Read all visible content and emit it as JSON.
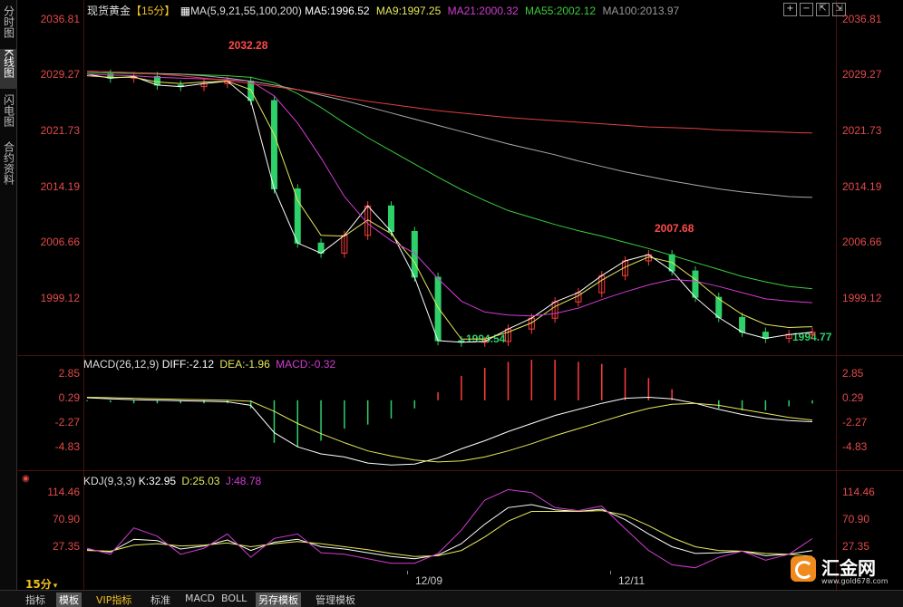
{
  "side_tabs": [
    "分时图",
    "K线图",
    "闪电图",
    "合约资料"
  ],
  "price_header": {
    "instrument": "现货黄金",
    "period": "【15分】",
    "ma_def": "MA(5,9,21,55,100,200)",
    "ma5": "MA5:1996.52",
    "ma9": "MA9:1997.25",
    "ma21": "MA21:2000.32",
    "ma55": "MA55:2002.12",
    "ma100": "MA100:2013.97"
  },
  "price_axis": [
    "2036.81",
    "2029.27",
    "2021.73",
    "2014.19",
    "2006.66",
    "1999.12"
  ],
  "annotations": {
    "high1": "2032.28",
    "high2": "2007.68",
    "low1": "1994.54",
    "low2": "1994.77"
  },
  "macd_header": {
    "def": "MACD(26,12,9)",
    "diff": "DIFF:-2.12",
    "dea": "DEA:-1.96",
    "macd": "MACD:-0.32"
  },
  "macd_axis": [
    "2.85",
    "0.29",
    "-2.27",
    "-4.83"
  ],
  "kdj_header": {
    "def": "KDJ(9,3,3)",
    "k": "K:32.95",
    "d": "D:25.03",
    "j": "J:48.78"
  },
  "kdj_axis": [
    "114.46",
    "70.90",
    "27.35"
  ],
  "dates": [
    "12/09",
    "12/11"
  ],
  "period_label": "15分",
  "bottom_tabs": [
    "指标",
    "模板",
    "VIP指标",
    "标准",
    "MACD",
    "BOLL",
    "另存模板",
    "管理模板"
  ],
  "logo": {
    "brand": "汇金网",
    "url": "www.gold678.com"
  },
  "colors": {
    "up": "#ff3c3c",
    "down": "#2ed06a",
    "ma5": "#ffffff",
    "ma9": "#e8e85a",
    "ma21": "#d23cd2",
    "ma55": "#3ccc3c",
    "ma100": "#aaaaaa",
    "ma200": "#e04040",
    "axis_text": "#e24a4a",
    "divider": "#4a1010"
  },
  "chart_data": {
    "type": "line",
    "title": "现货黄金 15分",
    "series": [
      {
        "name": "MA5",
        "values": [
          2029.8,
          2029.3,
          2029.5,
          2028.4,
          2028.2,
          2028.6,
          2028.9,
          2026.4,
          2015.0,
          2008.0,
          2006.7,
          2009.0,
          2012.8,
          2009.5,
          2003.6,
          1995.4,
          1995.2,
          1995.3,
          1996.9,
          1998.3,
          2000.4,
          2001.6,
          2003.8,
          2005.7,
          2006.5,
          2004.4,
          2001.0,
          1998.4,
          1996.5,
          1995.7,
          1996.2,
          1996.5
        ]
      },
      {
        "name": "MA9",
        "values": [
          2029.6,
          2029.4,
          2029.4,
          2028.8,
          2028.6,
          2028.8,
          2028.9,
          2027.8,
          2022.0,
          2013.5,
          2009.0,
          2008.9,
          2011.0,
          2009.2,
          2005.5,
          1999.7,
          1995.6,
          1995.6,
          1996.5,
          1997.7,
          1999.8,
          2001.2,
          2003.2,
          2004.9,
          2006.2,
          2005.5,
          2003.3,
          2000.8,
          1998.8,
          1997.5,
          1997.1,
          1997.2
        ]
      },
      {
        "name": "MA21",
        "values": [
          2029.8,
          2029.7,
          2029.6,
          2029.4,
          2029.3,
          2029.2,
          2029.1,
          2028.9,
          2027.0,
          2023.5,
          2019.0,
          2014.0,
          2010.5,
          2008.3,
          2006.7,
          2003.4,
          2000.5,
          1999.1,
          1998.7,
          1998.6,
          1998.9,
          1999.6,
          2000.7,
          2001.7,
          2002.6,
          2003.3,
          2003.1,
          2002.4,
          2001.6,
          2000.8,
          2000.5,
          2000.3
        ]
      },
      {
        "name": "MA55",
        "values": [
          2030.0,
          2029.95,
          2029.9,
          2029.85,
          2029.8,
          2029.7,
          2029.6,
          2029.4,
          2028.7,
          2027.3,
          2025.5,
          2023.5,
          2021.6,
          2019.9,
          2018.2,
          2016.5,
          2014.9,
          2013.5,
          2012.2,
          2011.3,
          2010.4,
          2009.6,
          2008.9,
          2008.1,
          2007.3,
          2006.4,
          2005.5,
          2004.6,
          2003.7,
          2003.0,
          2002.4,
          2002.1
        ]
      },
      {
        "name": "MA100",
        "values": [
          2030.2,
          2030.1,
          2030.0,
          2029.9,
          2029.8,
          2029.6,
          2029.3,
          2028.9,
          2028.4,
          2027.8,
          2027.1,
          2026.4,
          2025.6,
          2024.8,
          2024.0,
          2023.2,
          2022.4,
          2021.6,
          2020.8,
          2020.1,
          2019.4,
          2018.6,
          2017.9,
          2017.2,
          2016.6,
          2016.0,
          2015.5,
          2015.0,
          2014.6,
          2014.3,
          2014.0,
          2013.9
        ]
      },
      {
        "name": "MA200",
        "values": [
          2030.2,
          2030.1,
          2030.0,
          2029.8,
          2029.6,
          2029.3,
          2029.0,
          2028.6,
          2028.2,
          2027.8,
          2027.3,
          2026.8,
          2026.3,
          2025.9,
          2025.5,
          2025.1,
          2024.8,
          2024.5,
          2024.2,
          2024.0,
          2023.8,
          2023.6,
          2023.4,
          2023.2,
          2023.0,
          2022.9,
          2022.8,
          2022.6,
          2022.5,
          2022.4,
          2022.3,
          2022.2
        ]
      }
    ],
    "macd": {
      "diff": [
        0.25,
        0.15,
        0.05,
        0.0,
        -0.05,
        -0.1,
        -0.15,
        -0.5,
        -3.2,
        -4.6,
        -5.3,
        -5.6,
        -6.2,
        -6.4,
        -6.3,
        -5.7,
        -4.8,
        -4.0,
        -3.1,
        -2.3,
        -1.5,
        -0.9,
        -0.3,
        0.2,
        0.3,
        0.15,
        -0.3,
        -0.9,
        -1.4,
        -1.8,
        -2.0,
        -2.12
      ],
      "dea": [
        0.3,
        0.25,
        0.2,
        0.15,
        0.1,
        0.05,
        0.0,
        -0.1,
        -1.1,
        -2.3,
        -3.3,
        -4.2,
        -5.0,
        -5.5,
        -5.9,
        -6.1,
        -6.0,
        -5.6,
        -5.0,
        -4.3,
        -3.5,
        -2.8,
        -2.1,
        -1.4,
        -0.8,
        -0.4,
        -0.3,
        -0.5,
        -0.9,
        -1.3,
        -1.7,
        -1.96
      ],
      "hist": [
        -0.1,
        -0.2,
        -0.3,
        -0.3,
        -0.3,
        -0.3,
        -0.3,
        -0.8,
        -4.2,
        -4.6,
        -4.0,
        -2.8,
        -2.4,
        -1.8,
        -0.8,
        0.8,
        2.4,
        3.2,
        3.8,
        4.0,
        4.0,
        3.8,
        3.6,
        3.2,
        2.2,
        1.1,
        0.0,
        -0.8,
        -1.0,
        -1.0,
        -0.6,
        -0.32
      ]
    },
    "kdj": {
      "k": [
        34,
        31,
        48,
        46,
        35,
        39,
        47,
        33,
        44,
        48,
        38,
        35,
        30,
        25,
        22,
        27,
        42,
        68,
        90,
        94,
        87,
        85,
        88,
        74,
        55,
        38,
        29,
        30,
        32,
        26,
        28,
        32.95
      ],
      "d": [
        33,
        32,
        40,
        42,
        39,
        40,
        43,
        38,
        42,
        45,
        42,
        38,
        34,
        29,
        25,
        26,
        33,
        51,
        72,
        85,
        85,
        85,
        86,
        80,
        66,
        50,
        38,
        33,
        32,
        29,
        28,
        25.03
      ],
      "j": [
        36,
        28,
        63,
        52,
        28,
        36,
        55,
        24,
        49,
        55,
        30,
        28,
        22,
        16,
        16,
        29,
        60,
        100,
        114,
        110,
        90,
        86,
        92,
        62,
        33,
        14,
        10,
        24,
        32,
        20,
        28,
        48.78
      ]
    },
    "ylim_price": [
      1994.0,
      2036.81
    ],
    "ylim_macd": [
      -7.0,
      2.85
    ],
    "ylim_kdj": [
      0,
      114.46
    ]
  }
}
